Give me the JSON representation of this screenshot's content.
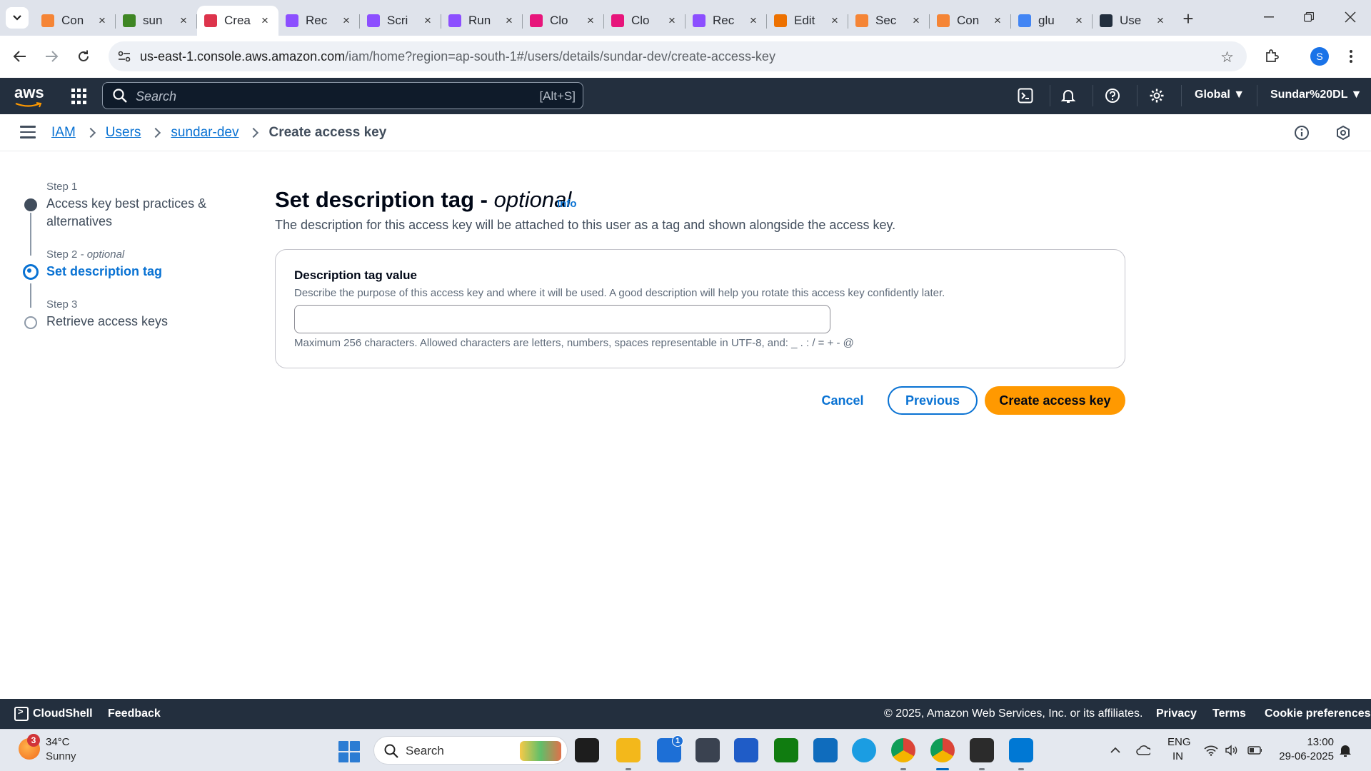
{
  "browser": {
    "tabs": [
      {
        "title": "Con",
        "icon": "aws-box-icon",
        "color": "#f58536",
        "active": false
      },
      {
        "title": "sun",
        "icon": "green-box-icon",
        "color": "#3f8624",
        "active": false
      },
      {
        "title": "Crea",
        "icon": "red-key-icon",
        "color": "#dd344c",
        "active": true
      },
      {
        "title": "Rec",
        "icon": "purple-icon",
        "color": "#8c4fff",
        "active": false
      },
      {
        "title": "Scri",
        "icon": "purple-branch-icon",
        "color": "#8c4fff",
        "active": false
      },
      {
        "title": "Run",
        "icon": "purple-branch-icon",
        "color": "#8c4fff",
        "active": false
      },
      {
        "title": "Clo",
        "icon": "pink-icon",
        "color": "#e7157b",
        "active": false
      },
      {
        "title": "Clo",
        "icon": "pink-icon",
        "color": "#e7157b",
        "active": false
      },
      {
        "title": "Rec",
        "icon": "purple-icon",
        "color": "#8c4fff",
        "active": false
      },
      {
        "title": "Edit",
        "icon": "orange-cube-icon",
        "color": "#ed7100",
        "active": false
      },
      {
        "title": "Sec",
        "icon": "orange-icon",
        "color": "#f58536",
        "active": false
      },
      {
        "title": "Con",
        "icon": "aws-box-icon",
        "color": "#f58536",
        "active": false
      },
      {
        "title": "glu",
        "icon": "google-icon",
        "color": "#4285f4",
        "active": false
      },
      {
        "title": "Use",
        "icon": "aws-dark-icon",
        "color": "#232f3e",
        "active": false
      }
    ],
    "new_tab_glyph": "+",
    "url_host": "us-east-1.console.aws.amazon.com",
    "url_path": "/iam/home?region=ap-south-1#/users/details/sundar-dev/create-access-key",
    "profile_initial": "S"
  },
  "aws_header": {
    "logo": "aws",
    "search_placeholder": "Search",
    "search_shortcut": "[Alt+S]",
    "region": "Global ▼",
    "account": "Sundar%20DL ▼"
  },
  "breadcrumb": {
    "items": [
      "IAM",
      "Users",
      "sundar-dev"
    ],
    "current": "Create access key"
  },
  "steps": [
    {
      "kicker": "Step 1",
      "kicker_optional": "",
      "title": "Access key best practices & alternatives",
      "state": "done"
    },
    {
      "kicker": "Step 2",
      "kicker_optional": "- optional",
      "title": "Set description tag",
      "state": "current"
    },
    {
      "kicker": "Step 3",
      "kicker_optional": "",
      "title": "Retrieve access keys",
      "state": "todo"
    }
  ],
  "page": {
    "heading": "Set description tag - ",
    "heading_optional": "optional",
    "info_link": "Info",
    "description": "The description for this access key will be attached to this user as a tag and shown alongside the access key.",
    "field_label": "Description tag value",
    "field_description": "Describe the purpose of this access key and where it will be used. A good description will help you rotate this access key confidently later.",
    "field_value": "",
    "field_constraint": "Maximum 256 characters. Allowed characters are letters, numbers, spaces representable in UTF-8, and: _ . : / = + - @"
  },
  "actions": {
    "cancel": "Cancel",
    "previous": "Previous",
    "create": "Create access key"
  },
  "footer": {
    "cloudshell": "CloudShell",
    "feedback": "Feedback",
    "copyright": "© 2025, Amazon Web Services, Inc. or its affiliates.",
    "privacy": "Privacy",
    "terms": "Terms",
    "cookie": "Cookie preferences"
  },
  "taskbar": {
    "weather_badge": "3",
    "temperature": "34°C",
    "condition": "Sunny",
    "search_label": "Search",
    "store_badge": "1",
    "language_1": "ENG",
    "language_2": "IN",
    "time": "13:00",
    "date": "29-06-2025"
  }
}
